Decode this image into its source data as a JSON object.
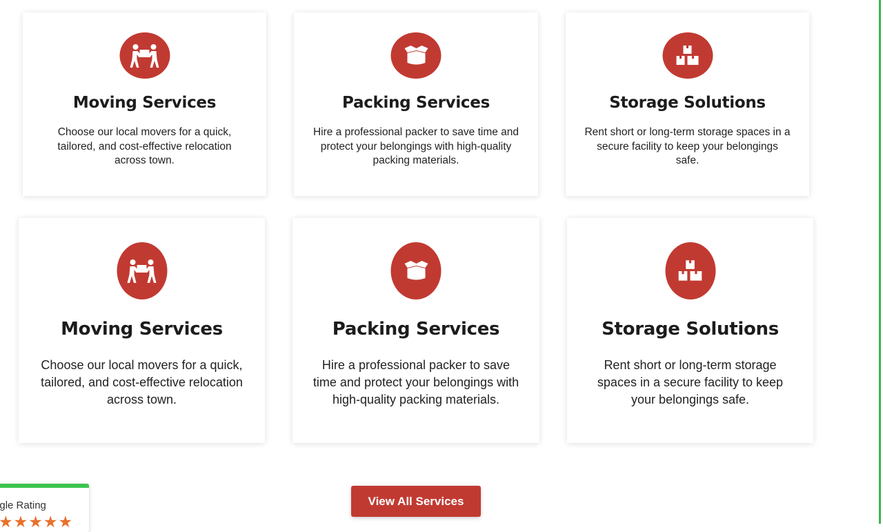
{
  "services_row_1": [
    {
      "icon": "people-carrying-box-icon",
      "title": "Moving Services",
      "description": "Choose our local movers for a quick, tailored, and cost-effective relocation across town."
    },
    {
      "icon": "open-box-icon",
      "title": "Packing Services",
      "description": "Hire a professional packer to save time and protect your belongings with high-quality packing materials."
    },
    {
      "icon": "stacked-boxes-icon",
      "title": "Storage Solutions",
      "description": "Rent short or long-term storage spaces in a secure facility to keep your belongings safe."
    }
  ],
  "services_row_2": [
    {
      "icon": "people-carrying-box-icon",
      "title": "Moving Services",
      "description": "Choose our local movers for a quick, tailored, and cost-effective relocation across town."
    },
    {
      "icon": "open-box-icon",
      "title": "Packing Services",
      "description": "Hire a professional packer to save time and protect your belongings with high-quality packing materials."
    },
    {
      "icon": "stacked-boxes-icon",
      "title": "Storage Solutions",
      "description": "Rent short or long-term storage spaces in a secure facility to keep your belongings safe."
    }
  ],
  "cta": {
    "label": "View All Services"
  },
  "rating_badge": {
    "label": "Google Rating",
    "stars": "★★★★★"
  },
  "colors": {
    "accent_red": "#c13a32",
    "accent_green": "#3cc44e",
    "star_orange": "#e8712b"
  }
}
